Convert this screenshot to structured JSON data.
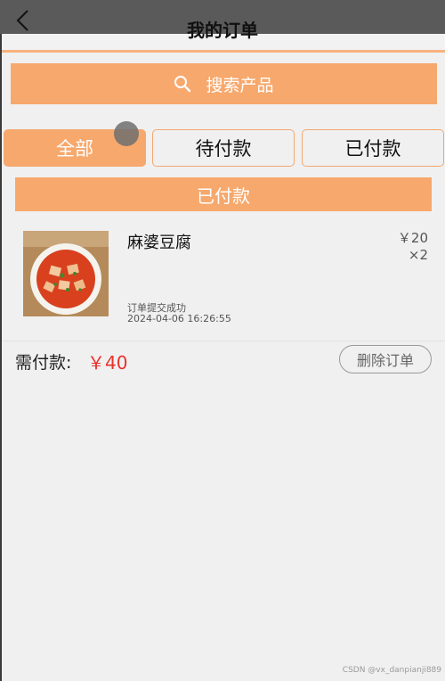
{
  "header": {
    "title": "我的订单"
  },
  "search": {
    "placeholder": "搜索产品"
  },
  "tabs": [
    {
      "label": "全部",
      "active": true
    },
    {
      "label": "待付款",
      "active": false
    },
    {
      "label": "已付款",
      "active": false
    }
  ],
  "section": {
    "title": "已付款"
  },
  "order": {
    "product_name": "麻婆豆腐",
    "price": "￥20",
    "quantity": "×2",
    "status": "订单提交成功",
    "time": "2024-04-06 16:26:55",
    "pay_label": "需付款:",
    "pay_amount": "￥40",
    "delete_label": "删除订单"
  },
  "watermark": "CSDN @vx_danpianji889",
  "colors": {
    "accent": "#f7a86c",
    "price_red": "#e8322a"
  }
}
